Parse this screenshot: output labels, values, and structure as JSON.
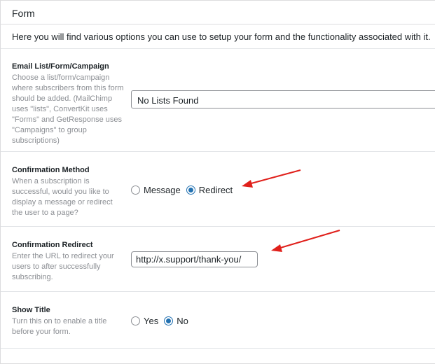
{
  "panel": {
    "title": "Form",
    "intro": "Here you will find various options you can use to setup your form and the functionality associated with it."
  },
  "fields": {
    "email_list": {
      "label": "Email List/Form/Campaign",
      "description": "Choose a list/form/campaign where subscribers from this form should be added. (MailChimp uses \"lists\", ConvertKit uses \"Forms\" and GetResponse uses \"Campaigns\" to group subscriptions)",
      "selected": "No Lists Found"
    },
    "confirmation_method": {
      "label": "Confirmation Method",
      "description": "When a subscription is successful, would you like to display a message or redirect the user to a page?",
      "options": [
        "Message",
        "Redirect"
      ],
      "selected": "Redirect"
    },
    "confirmation_redirect": {
      "label": "Confirmation Redirect",
      "description": "Enter the URL to redirect your users to after successfully subscribing.",
      "value": "http://x.support/thank-you/"
    },
    "show_title": {
      "label": "Show Title",
      "description": "Turn this on to enable a title before your form.",
      "options": [
        "Yes",
        "No"
      ],
      "selected": "No"
    }
  },
  "colors": {
    "accent": "#2271b1",
    "annotation_arrow": "#e0201b"
  }
}
